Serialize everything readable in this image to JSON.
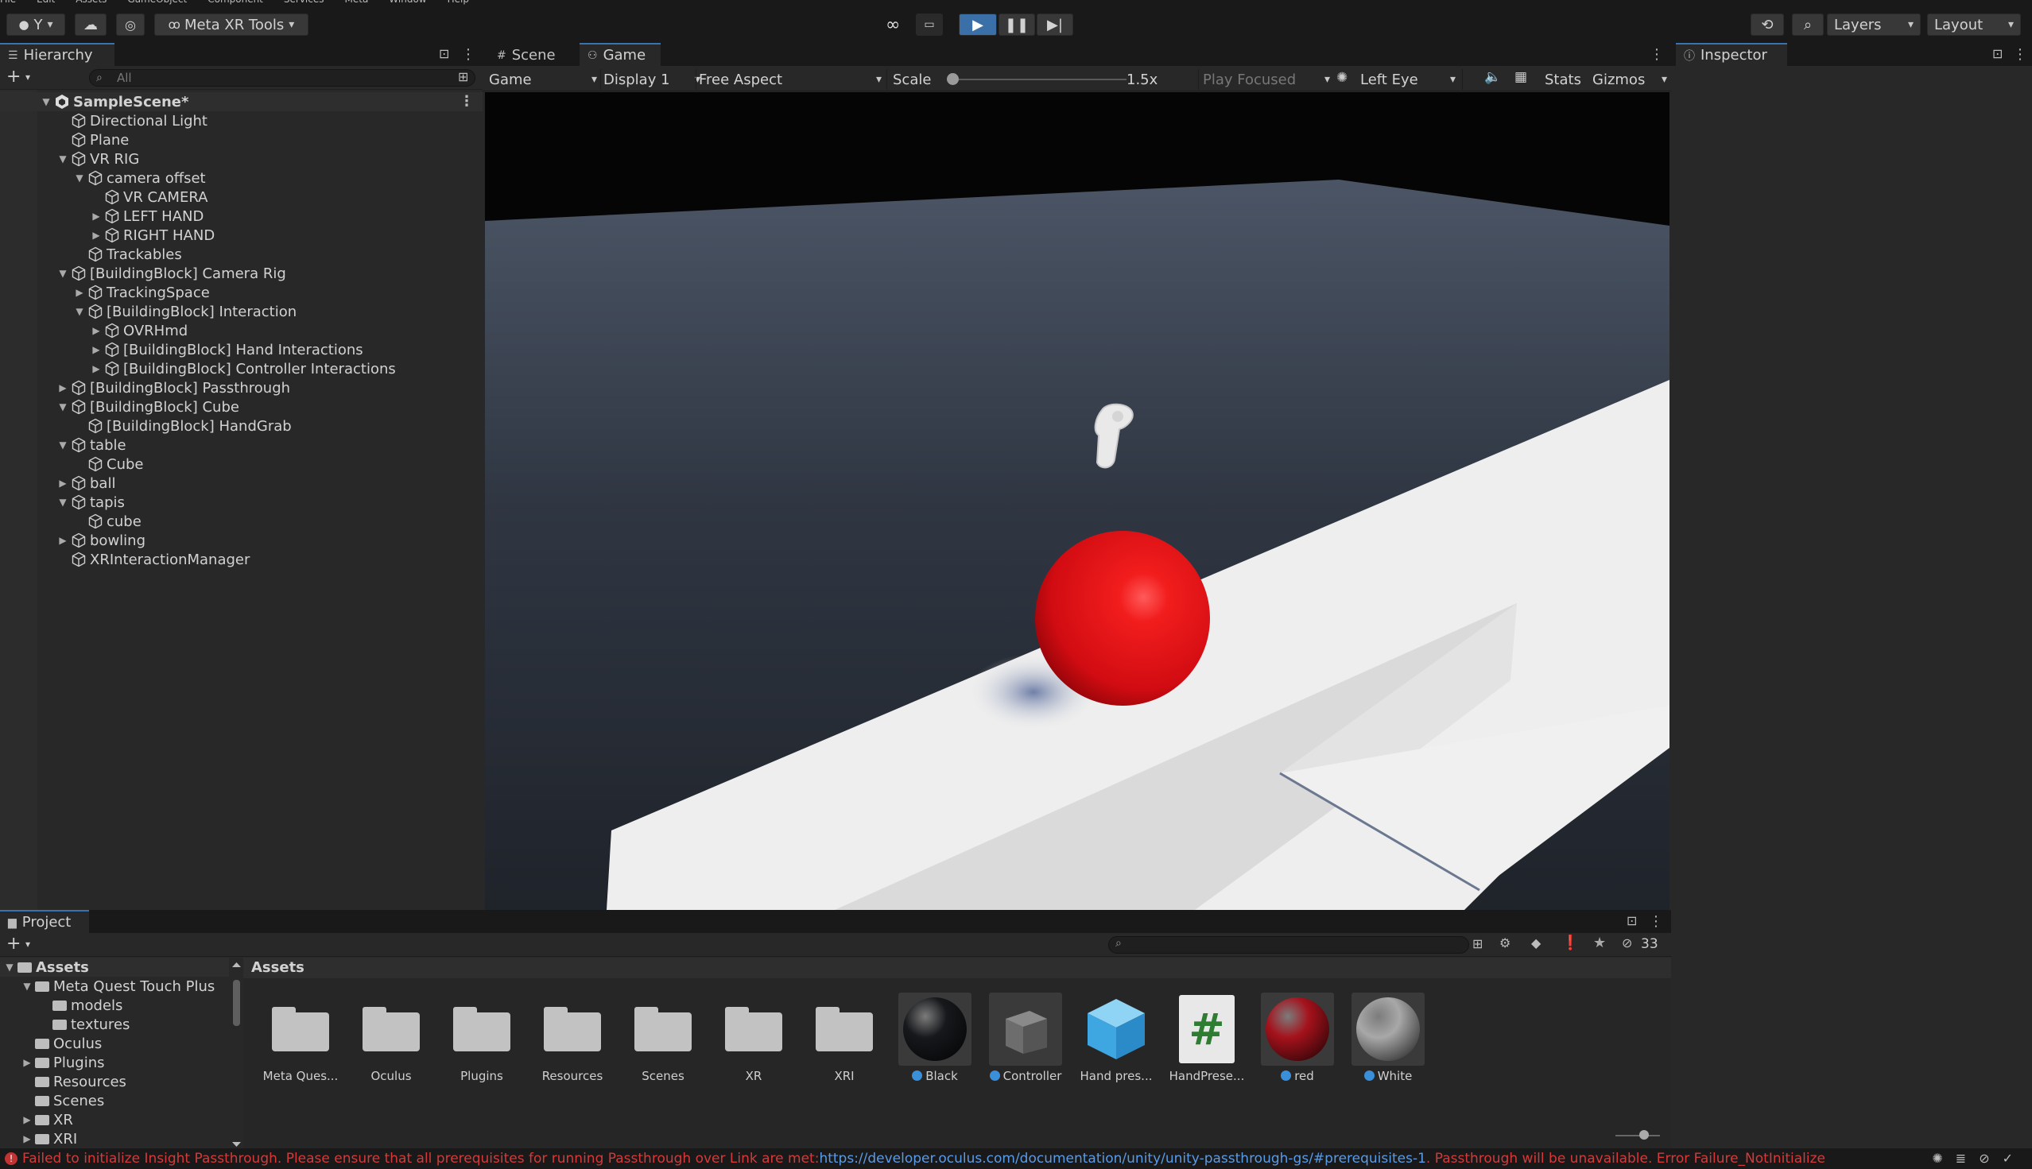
{
  "menubar": {
    "items": [
      "File",
      "Edit",
      "Assets",
      "GameObject",
      "Component",
      "Services",
      "Meta",
      "Window",
      "Help"
    ]
  },
  "toolbar": {
    "account_label": "Y",
    "meta_tools_label": "Meta XR Tools",
    "layers_label": "Layers",
    "layout_label": "Layout",
    "play_state": "playing",
    "accent_color": "#3a72b0"
  },
  "hierarchy": {
    "tab_label": "Hierarchy",
    "search_placeholder": "All",
    "scene_name": "SampleScene*",
    "items": [
      {
        "label": "Directional Light",
        "depth": 1,
        "expand": "none"
      },
      {
        "label": "Plane",
        "depth": 1,
        "expand": "none"
      },
      {
        "label": "VR RIG",
        "depth": 1,
        "expand": "open"
      },
      {
        "label": "camera offset",
        "depth": 2,
        "expand": "open"
      },
      {
        "label": "VR CAMERA",
        "depth": 3,
        "expand": "none"
      },
      {
        "label": "LEFT HAND",
        "depth": 3,
        "expand": "closed"
      },
      {
        "label": "RIGHT HAND",
        "depth": 3,
        "expand": "closed"
      },
      {
        "label": "Trackables",
        "depth": 2,
        "expand": "none"
      },
      {
        "label": "[BuildingBlock] Camera Rig",
        "depth": 1,
        "expand": "open"
      },
      {
        "label": "TrackingSpace",
        "depth": 2,
        "expand": "closed"
      },
      {
        "label": "[BuildingBlock] Interaction",
        "depth": 2,
        "expand": "open"
      },
      {
        "label": "OVRHmd",
        "depth": 3,
        "expand": "closed"
      },
      {
        "label": "[BuildingBlock] Hand Interactions",
        "depth": 3,
        "expand": "closed"
      },
      {
        "label": "[BuildingBlock] Controller Interactions",
        "depth": 3,
        "expand": "closed"
      },
      {
        "label": "[BuildingBlock] Passthrough",
        "depth": 1,
        "expand": "closed"
      },
      {
        "label": "[BuildingBlock] Cube",
        "depth": 1,
        "expand": "open"
      },
      {
        "label": "[BuildingBlock] HandGrab",
        "depth": 2,
        "expand": "none"
      },
      {
        "label": "table",
        "depth": 1,
        "expand": "open"
      },
      {
        "label": "Cube",
        "depth": 2,
        "expand": "none"
      },
      {
        "label": "ball",
        "depth": 1,
        "expand": "closed"
      },
      {
        "label": "tapis",
        "depth": 1,
        "expand": "open"
      },
      {
        "label": "cube",
        "depth": 2,
        "expand": "none"
      },
      {
        "label": "bowling",
        "depth": 1,
        "expand": "closed"
      },
      {
        "label": "XRInteractionManager",
        "depth": 1,
        "expand": "none"
      }
    ]
  },
  "gameview": {
    "tabs": [
      "Scene",
      "Game"
    ],
    "active_tab": "Game",
    "mode_dropdown": "Game",
    "display_dropdown": "Display 1",
    "aspect_dropdown": "Free Aspect",
    "scale_label": "Scale",
    "scale_value": "1.5x",
    "scale_fraction": 0.0,
    "play_focused_label": "Play Focused",
    "eye_dropdown": "Left Eye",
    "stats_label": "Stats",
    "gizmos_label": "Gizmos"
  },
  "inspector": {
    "tab_label": "Inspector"
  },
  "project": {
    "tab_label": "Project",
    "hidden_count": "33",
    "breadcrumb": "Assets",
    "tree": [
      {
        "label": "Assets",
        "depth": 0,
        "expand": "open",
        "bold": true
      },
      {
        "label": "Meta Quest Touch Plus",
        "depth": 1,
        "expand": "open"
      },
      {
        "label": "models",
        "depth": 2,
        "expand": "none"
      },
      {
        "label": "textures",
        "depth": 2,
        "expand": "none"
      },
      {
        "label": "Oculus",
        "depth": 1,
        "expand": "none"
      },
      {
        "label": "Plugins",
        "depth": 1,
        "expand": "closed"
      },
      {
        "label": "Resources",
        "depth": 1,
        "expand": "none"
      },
      {
        "label": "Scenes",
        "depth": 1,
        "expand": "none"
      },
      {
        "label": "XR",
        "depth": 1,
        "expand": "closed"
      },
      {
        "label": "XRI",
        "depth": 1,
        "expand": "closed"
      }
    ],
    "assets": [
      {
        "label": "Meta Ques...",
        "kind": "folder"
      },
      {
        "label": "Oculus",
        "kind": "folder"
      },
      {
        "label": "Plugins",
        "kind": "folder"
      },
      {
        "label": "Resources",
        "kind": "folder"
      },
      {
        "label": "Scenes",
        "kind": "folder"
      },
      {
        "label": "XR",
        "kind": "folder"
      },
      {
        "label": "XRI",
        "kind": "folder"
      },
      {
        "label": "Black",
        "kind": "material",
        "color": "#16181b"
      },
      {
        "label": "Controller",
        "kind": "prefab"
      },
      {
        "label": "Hand pres...",
        "kind": "prefab-blue"
      },
      {
        "label": "HandPrese...",
        "kind": "script"
      },
      {
        "label": "red",
        "kind": "material",
        "color": "#a5121c"
      },
      {
        "label": "White",
        "kind": "material",
        "color": "#a8a8a8"
      }
    ]
  },
  "status": {
    "error_prefix": "Failed to initialize Insight Passthrough. Please ensure that all prerequisites for running Passthrough over Link are met: ",
    "error_link": "https://developer.oculus.com/documentation/unity/unity-passthrough-gs/#prerequisites-1",
    "error_suffix": ". Passthrough will be unavailable. Error Failure_NotInitialize",
    "error_color": "#d53a3a"
  }
}
